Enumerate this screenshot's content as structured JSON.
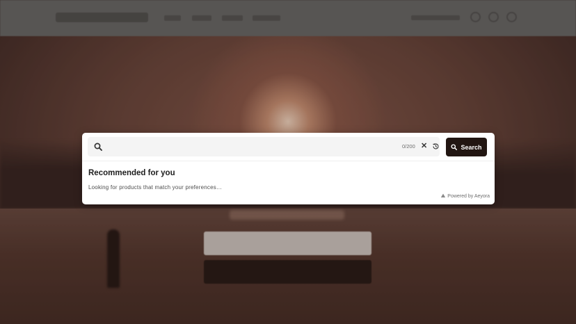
{
  "search": {
    "value": "",
    "placeholder": "",
    "counter": "0/200",
    "clear_glyph": "✕",
    "button_label": "Search"
  },
  "recommendations": {
    "title": "Recommended for you",
    "status": "Looking for products that match your preferences…"
  },
  "footer": {
    "powered_by": "Powered by Aeyora"
  },
  "icons": {
    "search": "search-icon",
    "clear": "close-icon",
    "history": "history-icon",
    "powered": "aeyora-logo-icon"
  },
  "colors": {
    "search_button_bg": "#221612",
    "modal_bg": "#ffffff",
    "search_box_bg": "#f4f4f4"
  }
}
